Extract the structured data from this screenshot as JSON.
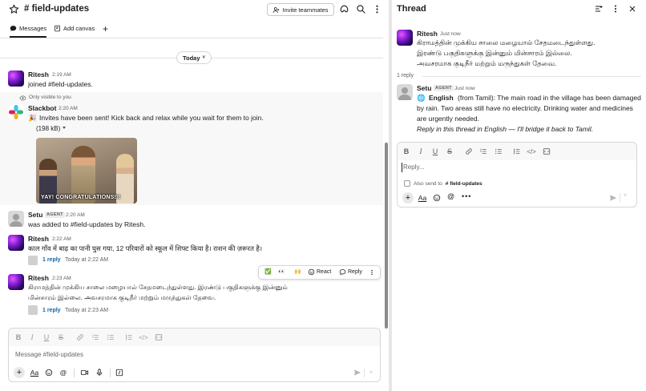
{
  "channel": {
    "name": "# field-updates",
    "invite_label": "Invite teammates",
    "tabs": [
      {
        "label": "Messages"
      },
      {
        "label": "Add canvas"
      }
    ],
    "day_label": "Today",
    "messages": [
      {
        "author": "Ritesh",
        "time": "2:19 AM",
        "text": "joined #field-updates."
      },
      {
        "visibility_note": "Only visible to you",
        "author": "Slackbot",
        "time": "2:20 AM",
        "emoji": "🎉",
        "text": "Invites have been sent! Kick back and relax while you wait for them to join.",
        "file_size": "(198 kB)",
        "gif_caption": "YAY! CONGRATULATIONS!!!"
      },
      {
        "author": "Setu",
        "tag": "AGENT",
        "time": "2:20 AM",
        "text": "was added to #field-updates by Ritesh."
      },
      {
        "author": "Ritesh",
        "time": "2:22 AM",
        "text": "काल गाँव में बाढ़ का पानी घुस गया, 12 परिवारों को स्कूल में शिफ्ट किया है। राशन की ज़रूरत है।",
        "reply_count": "1 reply",
        "reply_time": "Today at 2:22 AM"
      },
      {
        "author": "Ritesh",
        "time": "2:23 AM",
        "text_line1": "கிராமத்தின் முக்கிய சாலை மழையால் சேதமடைந்துள்ளது. இரண்டு பகுதிகளுக்கு இன்னும்",
        "text_line2": "மின்சாரம் இல்லை. அவசரமாக குடிநீர் மற்றும் மருந்துகள் தேவை.",
        "reply_count": "1 reply",
        "reply_time": "Today at 2:23 AM"
      }
    ],
    "hover_actions": {
      "check": "✅",
      "eyes": "👀",
      "hands": "🙌",
      "react": "React",
      "reply": "Reply"
    },
    "composer": {
      "placeholder": "Message #field-updates"
    }
  },
  "thread": {
    "title": "Thread",
    "parent": {
      "author": "Ritesh",
      "time": "Just now",
      "text_line1": "கிராமத்தின் முக்கிய சாலை மழையால் சேதமடைந்துள்ளது.",
      "text_line2": "இரண்டு பகுதிகளுக்கு இன்னும் மின்சாரம் இல்லை.",
      "text_line3": "அவசரமாக குடிநீர் மற்றும் மருந்துகள் தேவை."
    },
    "reply_count": "1 reply",
    "reply": {
      "author": "Setu",
      "tag": "AGENT",
      "time": "Just now",
      "globe": "🌐",
      "lang_bold": "English",
      "text_line1": "(from Tamil): The main road in the village has been damaged",
      "text_line2": "by rain. Two areas still have no electricity. Drinking water and medicines",
      "text_line3": "are urgently needed.",
      "text_line4": "Reply in this thread in English — I'll bridge it back to Tamil."
    },
    "composer": {
      "placeholder": "Reply...",
      "also_send_prefix": "Also send to",
      "also_send_channel": "# field-updates"
    }
  },
  "colors": {
    "link": "#1264a3",
    "accent_purple": "#8a1fd6",
    "muted": "#616061"
  }
}
